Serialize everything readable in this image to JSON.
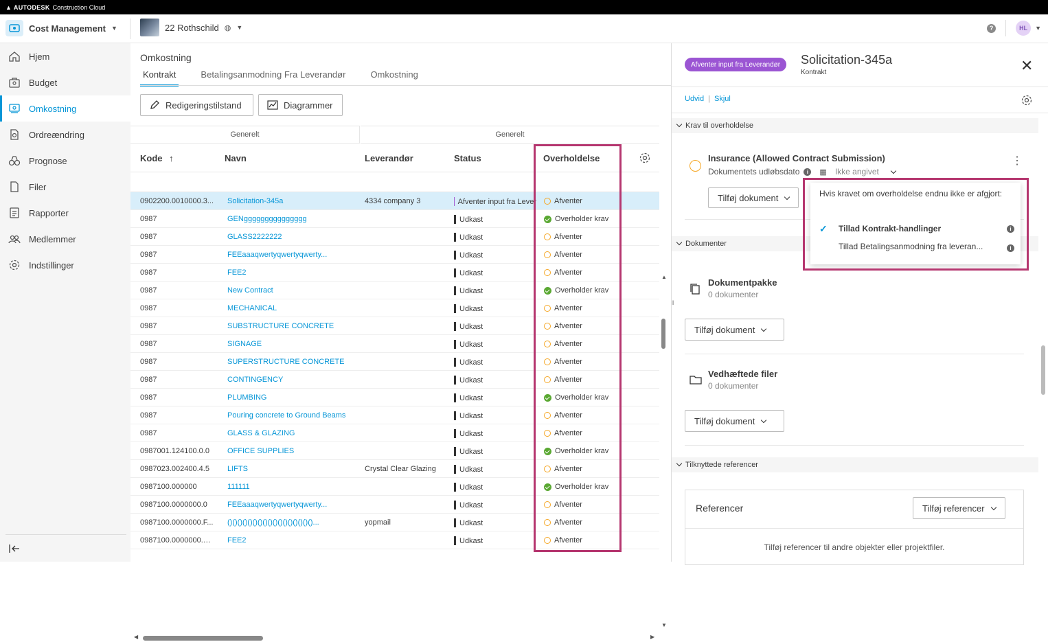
{
  "topbar": {
    "brand": "AUTODESK",
    "product": "Construction Cloud"
  },
  "header": {
    "module": "Cost Management",
    "project": "22 Rothschild",
    "avatar": "HL",
    "help": "?"
  },
  "sidebar": {
    "items": [
      {
        "label": "Hjem",
        "icon": "home-icon"
      },
      {
        "label": "Budget",
        "icon": "budget-icon"
      },
      {
        "label": "Omkostning",
        "icon": "cost-icon",
        "active": true
      },
      {
        "label": "Ordreændring",
        "icon": "change-order-icon"
      },
      {
        "label": "Prognose",
        "icon": "forecast-icon"
      },
      {
        "label": "Filer",
        "icon": "file-icon"
      },
      {
        "label": "Rapporter",
        "icon": "report-icon"
      },
      {
        "label": "Medlemmer",
        "icon": "members-icon"
      },
      {
        "label": "Indstillinger",
        "icon": "gear-icon"
      }
    ]
  },
  "main": {
    "title": "Omkostning",
    "tabs": [
      "Kontrakt",
      "Betalingsanmodning Fra Leverandør",
      "Omkostning"
    ],
    "buttons": {
      "edit": "Redigeringstilstand",
      "charts": "Diagrammer"
    },
    "groups": [
      "Generelt",
      "Generelt"
    ],
    "columns": {
      "code": "Kode",
      "name": "Navn",
      "supplier": "Leverandør",
      "status": "Status",
      "compliance": "Overholdelse"
    },
    "rows": [
      {
        "code": "0902200.0010000.3...",
        "name": "Solicitation-345a",
        "supplier": "4334 company 3",
        "status": "Afventer input fra Lever",
        "compliance": "Afventer",
        "ok": false
      },
      {
        "code": "0987",
        "name": "GENggggggggggggggg",
        "supplier": "",
        "status": "Udkast",
        "compliance": "Overholder krav",
        "ok": true
      },
      {
        "code": "0987",
        "name": "GLASS2222222",
        "supplier": "",
        "status": "Udkast",
        "compliance": "Afventer",
        "ok": false
      },
      {
        "code": "0987",
        "name": "FEEaaaqwertyqwertyqwerty...",
        "supplier": "",
        "status": "Udkast",
        "compliance": "Afventer",
        "ok": false
      },
      {
        "code": "0987",
        "name": "FEE2",
        "supplier": "",
        "status": "Udkast",
        "compliance": "Afventer",
        "ok": false
      },
      {
        "code": "0987",
        "name": "New Contract",
        "supplier": "",
        "status": "Udkast",
        "compliance": "Overholder krav",
        "ok": true
      },
      {
        "code": "0987",
        "name": "MECHANICAL",
        "supplier": "",
        "status": "Udkast",
        "compliance": "Afventer",
        "ok": false
      },
      {
        "code": "0987",
        "name": "SUBSTRUCTURE CONCRETE",
        "supplier": "",
        "status": "Udkast",
        "compliance": "Afventer",
        "ok": false
      },
      {
        "code": "0987",
        "name": "SIGNAGE",
        "supplier": "",
        "status": "Udkast",
        "compliance": "Afventer",
        "ok": false
      },
      {
        "code": "0987",
        "name": "SUPERSTRUCTURE CONCRETE",
        "supplier": "",
        "status": "Udkast",
        "compliance": "Afventer",
        "ok": false
      },
      {
        "code": "0987",
        "name": "CONTINGENCY",
        "supplier": "",
        "status": "Udkast",
        "compliance": "Afventer",
        "ok": false
      },
      {
        "code": "0987",
        "name": "PLUMBING",
        "supplier": "",
        "status": "Udkast",
        "compliance": "Overholder krav",
        "ok": true
      },
      {
        "code": "0987",
        "name": "Pouring concrete to Ground Beams",
        "supplier": "",
        "status": "Udkast",
        "compliance": "Afventer",
        "ok": false
      },
      {
        "code": "0987",
        "name": "GLASS & GLAZING",
        "supplier": "",
        "status": "Udkast",
        "compliance": "Afventer",
        "ok": false
      },
      {
        "code": "0987001.124100.0.0",
        "name": "OFFICE SUPPLIES",
        "supplier": "",
        "status": "Udkast",
        "compliance": "Overholder krav",
        "ok": true
      },
      {
        "code": "0987023.002400.4.5",
        "name": "LIFTS",
        "supplier": "Crystal Clear Glazing",
        "status": "Udkast",
        "compliance": "Afventer",
        "ok": false
      },
      {
        "code": "0987100.000000",
        "name": "111111",
        "supplier": "",
        "status": "Udkast",
        "compliance": "Overholder krav",
        "ok": true
      },
      {
        "code": "0987100.0000000.0",
        "name": "FEEaaaqwertyqwertyqwerty...",
        "supplier": "",
        "status": "Udkast",
        "compliance": "Afventer",
        "ok": false
      },
      {
        "code": "0987100.0000000.F...",
        "name": "()()()()()()()()()()()()()()()()()...",
        "supplier": "yopmail",
        "status": "Udkast",
        "compliance": "Afventer",
        "ok": false
      },
      {
        "code": "0987100.0000000.G...",
        "name": "FEE2",
        "supplier": "",
        "status": "Udkast",
        "compliance": "Afventer",
        "ok": false
      }
    ]
  },
  "panel": {
    "badge": "Afventer input fra Leverandør",
    "title": "Solicitation-345a",
    "subtitle": "Kontrakt",
    "expand": "Udvid",
    "hide": "Skjul",
    "sections": {
      "compliance": "Krav til overholdelse",
      "documents": "Dokumenter",
      "references": "Tilknyttede referencer"
    },
    "requirement": {
      "title": "Insurance (Allowed Contract Submission)",
      "expiry_label": "Dokumentets udløbsdato",
      "expiry_value": "Ikke angivet",
      "add_doc": "Tilføj dokument"
    },
    "popup": {
      "text": "Hvis kravet om overholdelse endnu ikke er afgjort:",
      "opt1": "Tillad Kontrakt-handlinger",
      "opt2": "Tillad Betalingsanmodning fra leveran..."
    },
    "package": {
      "title": "Dokumentpakke",
      "count": "0 dokumenter",
      "add": "Tilføj dokument"
    },
    "attachments": {
      "title": "Vedhæftede filer",
      "count": "0 dokumenter",
      "add": "Tilføj dokument"
    },
    "refs": {
      "title": "Referencer",
      "add": "Tilføj referencer",
      "empty": "Tilføj referencer til andre objekter eller projektfiler."
    }
  }
}
